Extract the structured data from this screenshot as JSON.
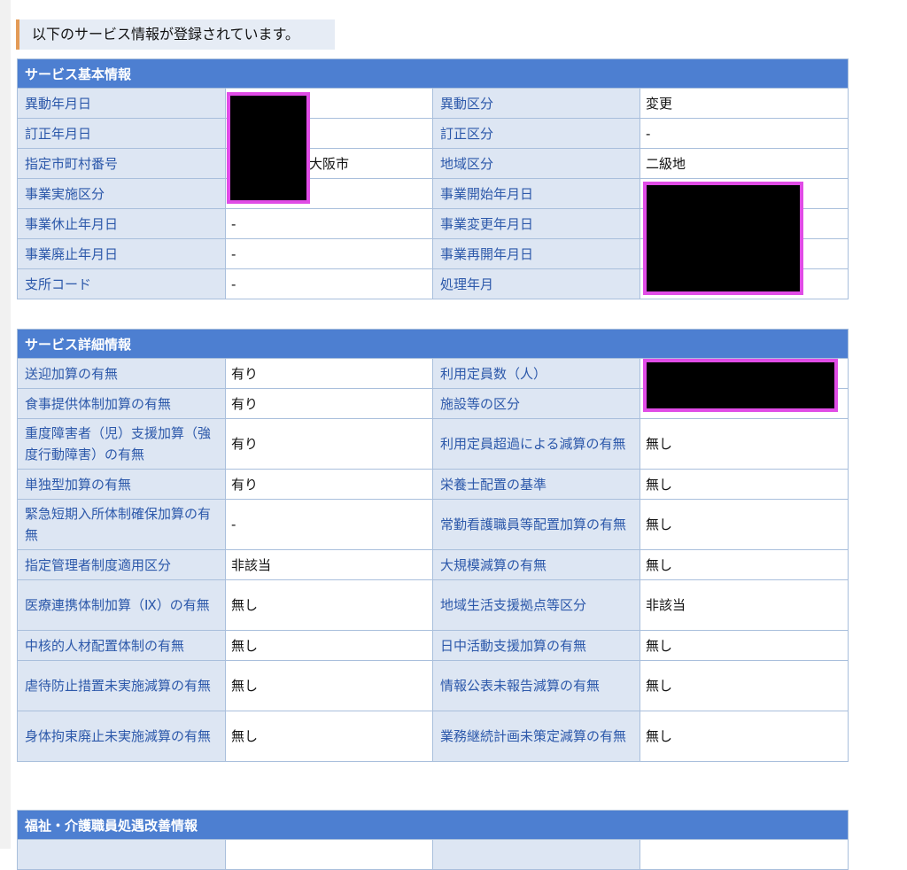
{
  "notice": "以下のサービス情報が登録されています。",
  "basic": {
    "title": "サービス基本情報",
    "rows": [
      {
        "l1": "異動年月日",
        "v1": "",
        "l2": "異動区分",
        "v2": "変更"
      },
      {
        "l1": "訂正年月日",
        "v1": "",
        "l2": "訂正区分",
        "v2": "-"
      },
      {
        "l1": "指定市町村番号",
        "v1": "大阪市",
        "l2": "地域区分",
        "v2": "二級地"
      },
      {
        "l1": "事業実施区分",
        "v1": "",
        "l2": "事業開始年月日",
        "v2": ""
      },
      {
        "l1": "事業休止年月日",
        "v1": "-",
        "l2": "事業変更年月日",
        "v2": ""
      },
      {
        "l1": "事業廃止年月日",
        "v1": "-",
        "l2": "事業再開年月日",
        "v2": ""
      },
      {
        "l1": "支所コード",
        "v1": "-",
        "l2": "処理年月",
        "v2": ""
      }
    ]
  },
  "detail": {
    "title": "サービス詳細情報",
    "rows": [
      {
        "l1": "送迎加算の有無",
        "v1": "有り",
        "l2": "利用定員数（人）",
        "v2": ""
      },
      {
        "l1": "食事提供体制加算の有無",
        "v1": "有り",
        "l2": "施設等の区分",
        "v2": ""
      },
      {
        "l1": "重度障害者（児）支援加算（強度行動障害）の有無",
        "v1": "有り",
        "l2": "利用定員超過による減算の有無",
        "v2": "無し"
      },
      {
        "l1": "単独型加算の有無",
        "v1": "有り",
        "l2": "栄養士配置の基準",
        "v2": "無し"
      },
      {
        "l1": "緊急短期入所体制確保加算の有無",
        "v1": "-",
        "l2": "常勤看護職員等配置加算の有無",
        "v2": "無し"
      },
      {
        "l1": "指定管理者制度適用区分",
        "v1": "非該当",
        "l2": "大規模減算の有無",
        "v2": "無し"
      },
      {
        "l1": "医療連携体制加算（Ⅸ）の有無",
        "v1": "無し",
        "l2": "地域生活支援拠点等区分",
        "v2": "非該当"
      },
      {
        "l1": "中核的人材配置体制の有無",
        "v1": "無し",
        "l2": "日中活動支援加算の有無",
        "v2": "無し"
      },
      {
        "l1": "虐待防止措置未実施減算の有無",
        "v1": "無し",
        "l2": "情報公表未報告減算の有無",
        "v2": "無し"
      },
      {
        "l1": "身体拘束廃止未実施減算の有無",
        "v1": "無し",
        "l2": "業務継続計画未策定減算の有無",
        "v2": "無し"
      }
    ]
  },
  "welfare": {
    "title": "福祉・介護職員処遇改善情報"
  }
}
